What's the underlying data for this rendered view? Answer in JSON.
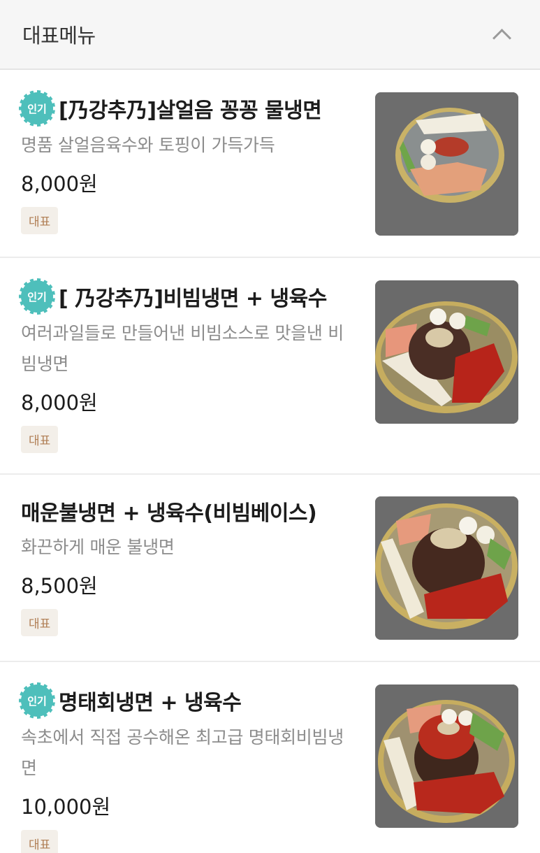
{
  "header": {
    "title": "대표메뉴",
    "collapse_icon": "chevron-up-icon"
  },
  "items": [
    {
      "popular": true,
      "badge": "인기",
      "name": "[乃강추乃]살얼음 꽁꽁 물냉면",
      "desc": "명품 살얼음육수와 토핑이 가득가득",
      "price": "8,000원",
      "tag": "대표"
    },
    {
      "popular": true,
      "badge": "인기",
      "name": "[ 乃강추乃]비빔냉면 + 냉육수",
      "desc": "여러과일들로 만들어낸 비빔소스로 맛을낸 비빔냉면",
      "price": "8,000원",
      "tag": "대표"
    },
    {
      "popular": false,
      "badge": "",
      "name": "매운불냉면 + 냉육수(비빔베이스)",
      "desc": "화끈하게 매운 불냉면",
      "price": "8,500원",
      "tag": "대표"
    },
    {
      "popular": true,
      "badge": "인기",
      "name": "명태회냉면 + 냉육수",
      "desc": "속초에서 직접 공수해온 최고급 명태회비빔냉면",
      "price": "10,000원",
      "tag": "대표"
    }
  ]
}
